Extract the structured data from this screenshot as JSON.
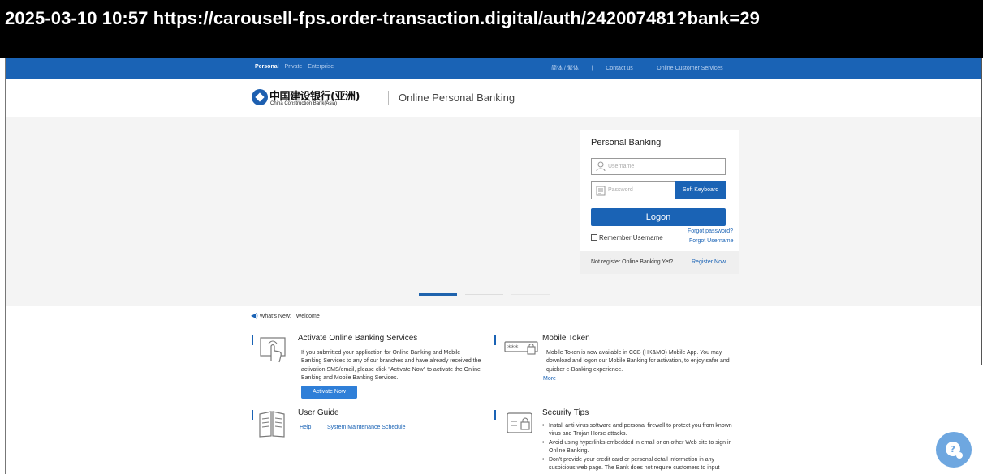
{
  "capture": {
    "text": "2025-03-10 10:57  https://carousell-fps.order-transaction.digital/auth/242007481?bank=29"
  },
  "topnav": {
    "left_items": [
      {
        "label": "Personal",
        "active": true
      },
      {
        "label": "Private",
        "active": false
      },
      {
        "label": "Enterprise",
        "active": false
      }
    ],
    "lang": "简体 / 繁体",
    "sep1": "|",
    "contact": "Contact us",
    "sep2": "|",
    "customer_services": "Online Customer Services"
  },
  "header": {
    "logo_cn": "中国建设银行(亚洲)",
    "logo_en": "China Construction Bank(Asia)",
    "subtitle": "Online Personal Banking"
  },
  "login": {
    "title": "Personal Banking",
    "username_placeholder": "Username",
    "password_placeholder": "Password",
    "soft_keyboard": "Soft Keyboard",
    "logon": "Logon",
    "remember": "Remember Username",
    "forgot_password": "Forgot password?",
    "forgot_username": "Forgot Username",
    "not_registered": "Not register Online Banking Yet?",
    "register_now": "Register Now"
  },
  "whats_new": {
    "label": "What's New:",
    "value": "Welcome"
  },
  "sections": {
    "activate": {
      "title": "Activate Online Banking Services",
      "body": "If you submitted your application for Online Banking and Mobile Banking Services to any of our branches and have already received the activation SMS/email, please click \"Activate Now\" to activate the Online Banking and Mobile Banking Services.",
      "button": "Activate Now"
    },
    "mobile_token": {
      "title": "Mobile Token",
      "body": "Mobile Token is now available in CCB (HK&MO) Mobile App. You may download and logon our Mobile Banking for activation, to enjoy safer and quicker e-Banking experience.",
      "more": "More"
    },
    "user_guide": {
      "title": "User Guide",
      "help": "Help",
      "maintenance": "System Maintenance Schedule"
    },
    "security": {
      "title": "Security Tips",
      "tips": [
        "Install anti-virus software and personal firewall to protect you from known virus and Trojan Horse attacks.",
        "Avoid using hyperlinks embedded in email or on other Web site to sign in Online Banking.",
        "Don't provide your credit card or personal detail information in any suspicious web page. The Bank does not require customers to input"
      ]
    }
  },
  "colors": {
    "brand_blue": "#1a63b5",
    "hero_bg": "#f4f4f4"
  }
}
